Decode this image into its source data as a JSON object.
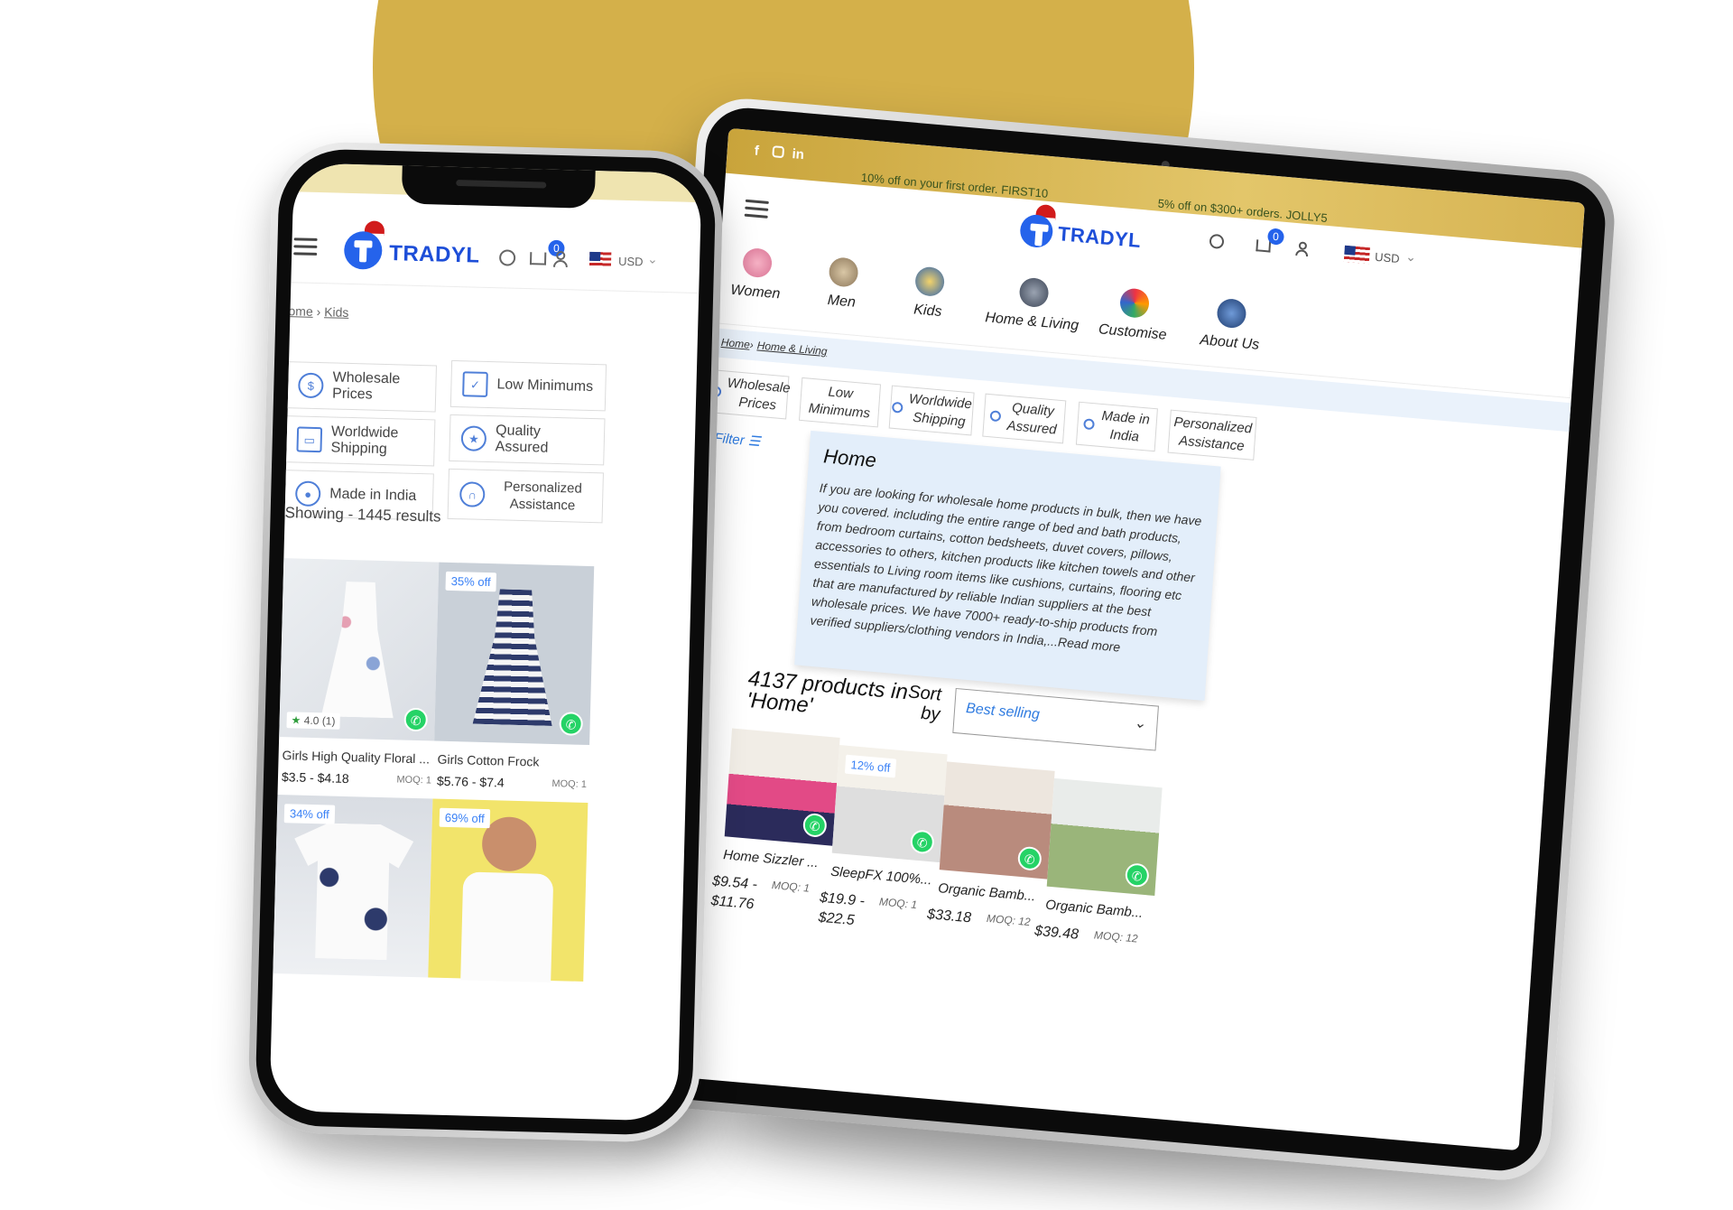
{
  "colors": {
    "gold": "#d4b04a",
    "brand_blue": "#1d4ed8",
    "accent_blue": "#2f7be0",
    "whatsapp_green": "#25d366",
    "description_bg": "#e3eefa"
  },
  "phone": {
    "header": {
      "logo_text": "TRADYL",
      "cart_count": "0",
      "currency": "USD",
      "icons": [
        "menu-icon",
        "search-icon",
        "cart-icon",
        "user-icon",
        "us-flag-icon",
        "chevron-down-icon"
      ]
    },
    "breadcrumb": {
      "home": "ome",
      "separator": "›",
      "current": "Kids"
    },
    "features": [
      {
        "label": "Wholesale Prices",
        "icon": "dollar-icon"
      },
      {
        "label": "Low Minimums",
        "icon": "checklist-icon"
      },
      {
        "label": "Worldwide Shipping",
        "icon": "truck-icon"
      },
      {
        "label": "Quality Assured",
        "icon": "award-icon"
      },
      {
        "label": "Made in India",
        "icon": "india-seal-icon"
      },
      {
        "label": "Personalized Assistance",
        "icon": "headset-icon"
      }
    ],
    "showing": "Showing - 1445 results",
    "products": [
      {
        "name": "Girls High Quality Floral ...",
        "price": "$3.5 - $4.18",
        "moq": "MOQ: 1",
        "discount": "",
        "rating": "4.0",
        "reviews": "(1)"
      },
      {
        "name": "Girls Cotton Frock",
        "price": "$5.76 - $7.4",
        "moq": "MOQ: 1",
        "discount": "35% off",
        "rating": "",
        "reviews": ""
      },
      {
        "name": "",
        "price": "",
        "moq": "",
        "discount": "34% off",
        "rating": "",
        "reviews": ""
      },
      {
        "name": "",
        "price": "",
        "moq": "",
        "discount": "69% off",
        "rating": "",
        "reviews": ""
      }
    ]
  },
  "tablet": {
    "social": [
      "f",
      "in"
    ],
    "promo_1": "10% off on your first order. FIRST10",
    "promo_2": "5% off on $300+ orders. JOLLY5",
    "header": {
      "logo_text": "TRADYL",
      "cart_count": "0",
      "currency": "USD",
      "icons": [
        "menu-icon",
        "search-icon",
        "cart-icon",
        "user-icon",
        "us-flag-icon",
        "chevron-down-icon"
      ]
    },
    "nav": [
      "Women",
      "Men",
      "Kids",
      "Home & Living",
      "Customise",
      "About Us"
    ],
    "breadcrumb": {
      "home": "Home",
      "separator": "›",
      "current": "Home & Living"
    },
    "features": [
      "Wholesale Prices",
      "Low Minimums",
      "Worldwide Shipping",
      "Quality Assured",
      "Made in India",
      "Personalized Assistance"
    ],
    "filter": "Filter",
    "description": {
      "title": "Home",
      "text": "If you are looking for wholesale home products in bulk, then we have you covered. including the entire range of bed and bath products, from bedroom curtains, cotton bedsheets, duvet covers, pillows, accessories to others, kitchen products like kitchen towels and other essentials to Living room items like cushions, curtains, flooring etc that are manufactured by reliable Indian suppliers at the best wholesale prices. We have 7000+ ready-to-ship products from verified suppliers/clothing vendors in India,...Read more"
    },
    "count_line1": "4137 products in",
    "count_line2": "'Home'",
    "sort_line1": "Sort",
    "sort_line2": "by",
    "sort_value": "Best selling",
    "products": [
      {
        "name": "Home Sizzler ...",
        "price_1": "$9.54 -",
        "price_2": "$11.76",
        "moq": "MOQ: 1",
        "discount": ""
      },
      {
        "name": "SleepFX 100%...",
        "price_1": "$19.9 -",
        "price_2": "$22.5",
        "moq": "MOQ: 1",
        "discount": "12% off"
      },
      {
        "name": "Organic Bamb...",
        "price_1": "$33.18",
        "price_2": "",
        "moq": "MOQ: 12",
        "discount": ""
      },
      {
        "name": "Organic Bamb...",
        "price_1": "$39.48",
        "price_2": "",
        "moq": "MOQ: 12",
        "discount": ""
      }
    ]
  }
}
